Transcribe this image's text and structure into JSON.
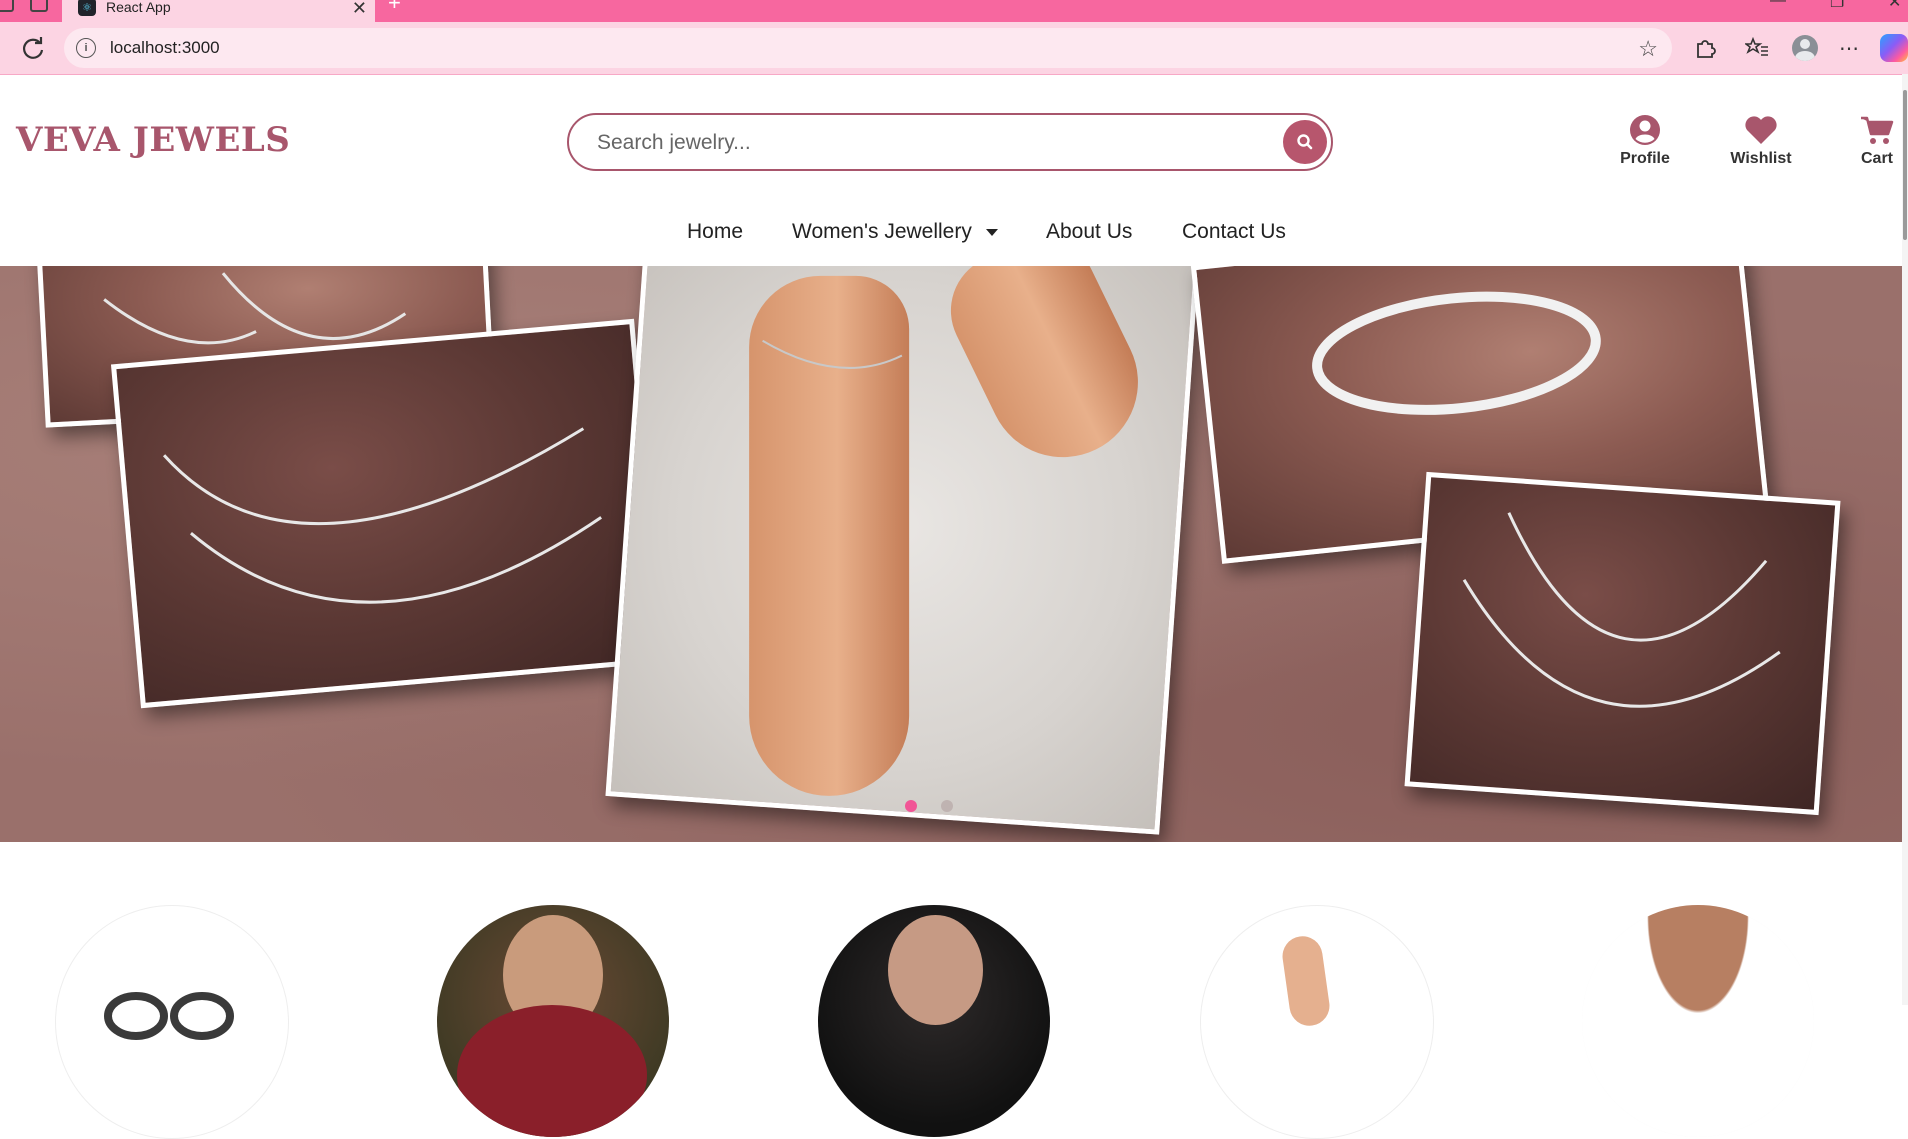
{
  "browser": {
    "tab_title": "React App",
    "url": "localhost:3000"
  },
  "site": {
    "logo": "VEVA JEWELS",
    "brand_color": "#a8566c"
  },
  "search": {
    "placeholder": "Search jewelry...",
    "button_icon": "search-icon"
  },
  "header_actions": [
    {
      "label": "Profile",
      "icon": "user-circle-icon"
    },
    {
      "label": "Wishlist",
      "icon": "heart-icon"
    },
    {
      "label": "Cart",
      "icon": "cart-icon"
    }
  ],
  "nav": {
    "items": [
      {
        "label": "Home"
      },
      {
        "label": "Women's Jewellery",
        "has_dropdown": true
      },
      {
        "label": "About Us"
      },
      {
        "label": "Contact Us"
      }
    ]
  },
  "hero": {
    "slides": 2,
    "active_slide": 1,
    "dot_active_color": "#f15596"
  }
}
